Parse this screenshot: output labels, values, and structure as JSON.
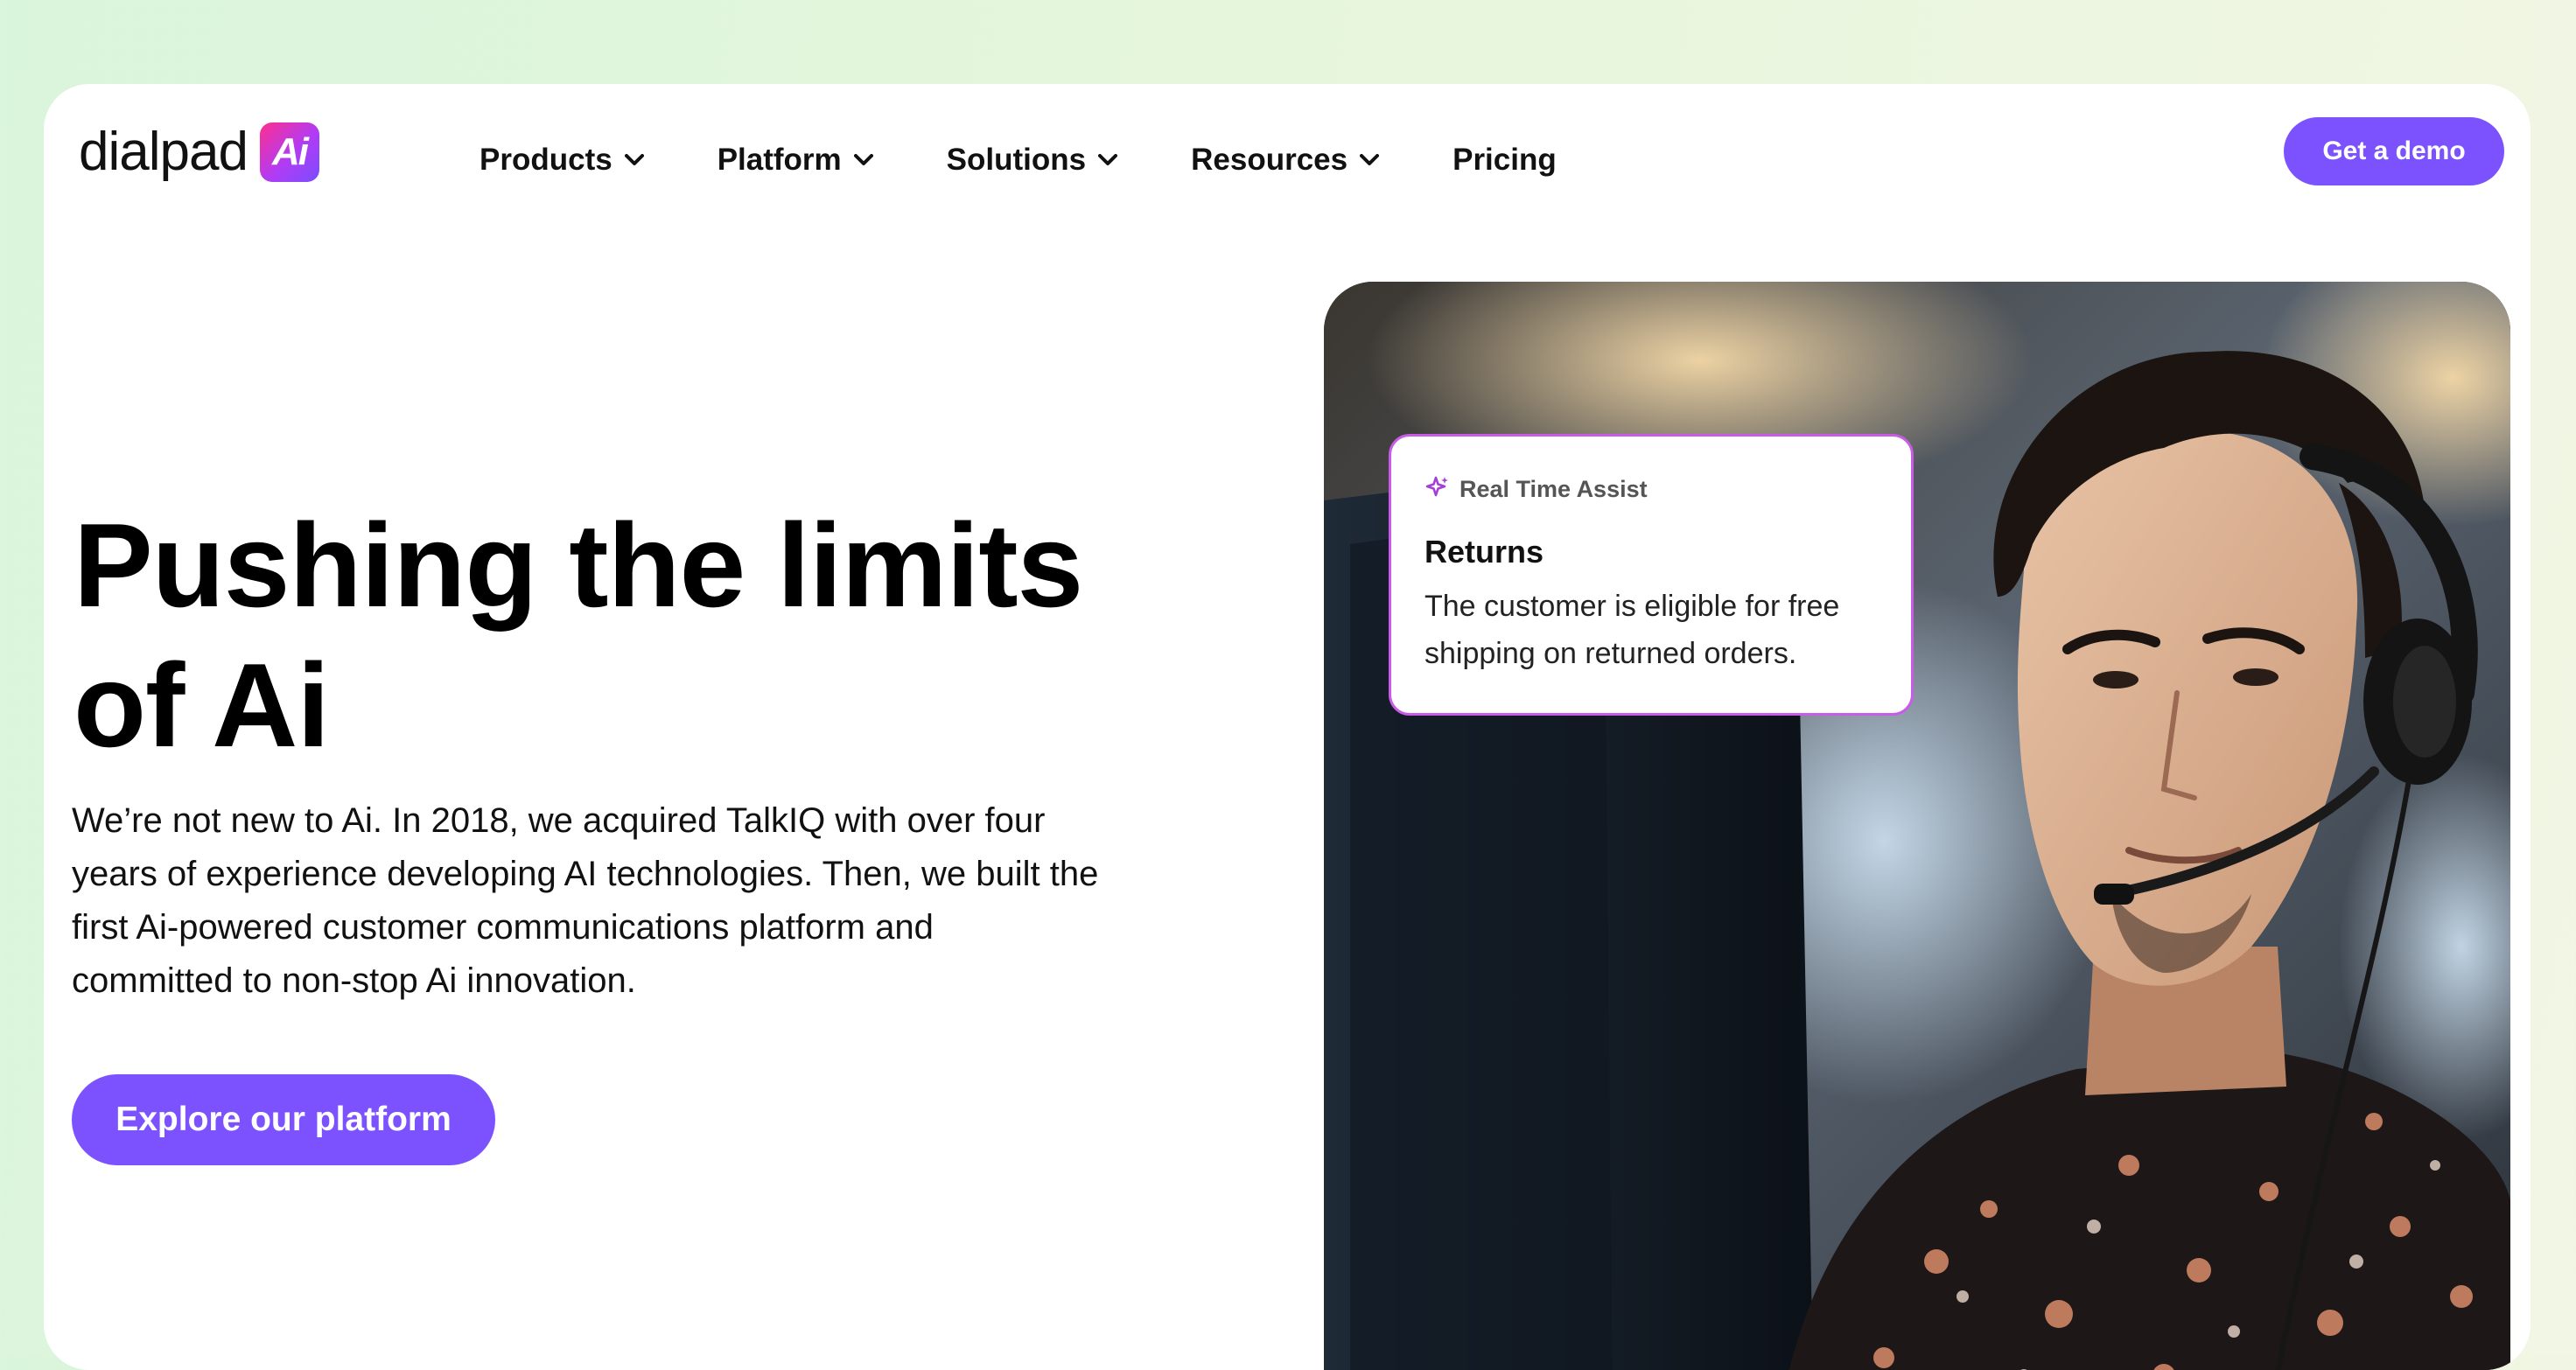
{
  "header": {
    "logo_text": "dialpad",
    "logo_badge": "Ai",
    "nav": [
      {
        "label": "Products",
        "has_dropdown": true
      },
      {
        "label": "Platform",
        "has_dropdown": true
      },
      {
        "label": "Solutions",
        "has_dropdown": true
      },
      {
        "label": "Resources",
        "has_dropdown": true
      },
      {
        "label": "Pricing",
        "has_dropdown": false
      }
    ],
    "cta_label": "Get a demo"
  },
  "hero": {
    "title_line1": "Pushing the limits",
    "title_line2": "of Ai",
    "description": "We’re not new to Ai. In 2018, we acquired TalkIQ with over four years of experience developing AI technologies. Then, we built the first Ai-powered customer communications platform and committed to non-stop Ai innovation.",
    "cta_label": "Explore our platform",
    "image_icon": "agent-with-headset-photo"
  },
  "assist_card": {
    "icon": "sparkle-icon",
    "tag": "Real Time Assist",
    "title": "Returns",
    "text": "The customer is eligible for free shipping on returned orders."
  },
  "colors": {
    "accent": "#7c52ff",
    "card_border": "#c85ce6",
    "background_start": "#d9f5dc",
    "background_end": "#f2f6e4"
  }
}
